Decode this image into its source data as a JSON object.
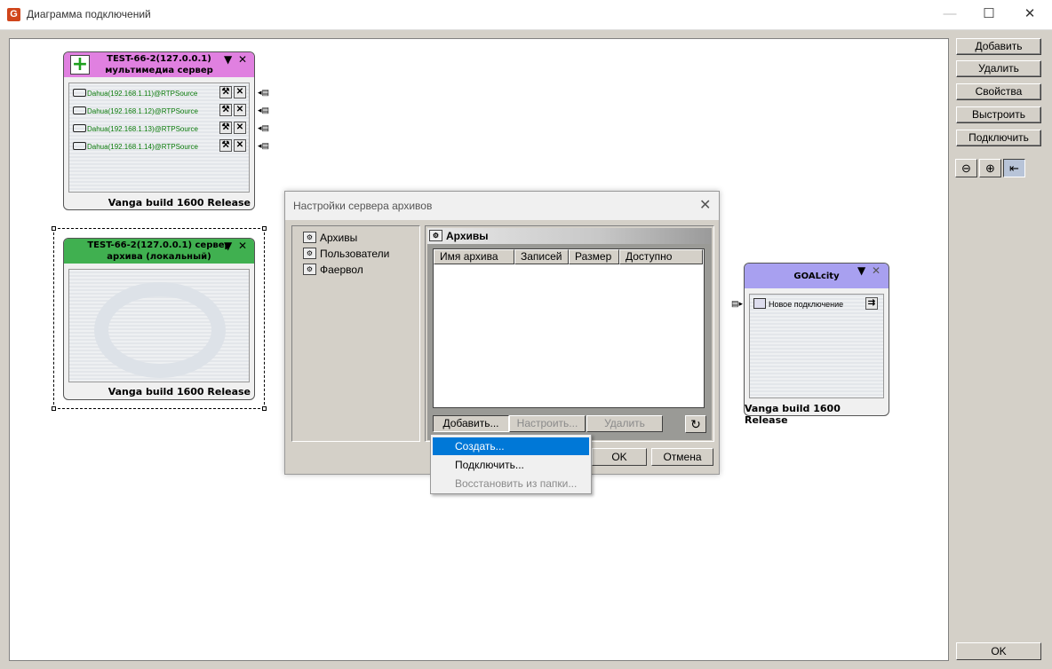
{
  "window": {
    "title": "Диаграмма подключений",
    "icon": "app-logo-icon"
  },
  "toolbar": {
    "buttons": [
      "Добавить",
      "Удалить",
      "Свойства",
      "Выстроить",
      "Подключить"
    ],
    "ok": "OK"
  },
  "nodes": {
    "multimedia": {
      "title_line1": "TEST-66-2(127.0.0.1)",
      "title_line2": "мультимедиа сервер",
      "header_color": "#e080e0",
      "streams": [
        "Dahua(192.168.1.11)@RTPSource",
        "Dahua(192.168.1.12)@RTPSource",
        "Dahua(192.168.1.13)@RTPSource",
        "Dahua(192.168.1.14)@RTPSource"
      ],
      "footer": "Vanga build  1600 Release"
    },
    "archive": {
      "title_line1": "TEST-66-2(127.0.0.1) сервер",
      "title_line2": "архива (локальный)",
      "header_color": "#40b050",
      "footer": "Vanga build  1600 Release"
    },
    "goalcity": {
      "title": "GOALcity",
      "header_color": "#a8a0f0",
      "connection": "Новое подключение",
      "footer": "Vanga build  1600 Release"
    }
  },
  "dialog": {
    "title": "Настройки сервера архивов",
    "tree": [
      "Архивы",
      "Пользователи",
      "Фаервол"
    ],
    "panel_title": "Архивы",
    "columns": [
      "Имя архива",
      "Записей",
      "Размер",
      "Доступно"
    ],
    "add": "Добавить...",
    "configure": "Настроить...",
    "delete": "Удалить",
    "ok": "OK",
    "cancel": "Отмена"
  },
  "context_menu": [
    "Создать...",
    "Подключить...",
    "Восстановить из папки..."
  ]
}
